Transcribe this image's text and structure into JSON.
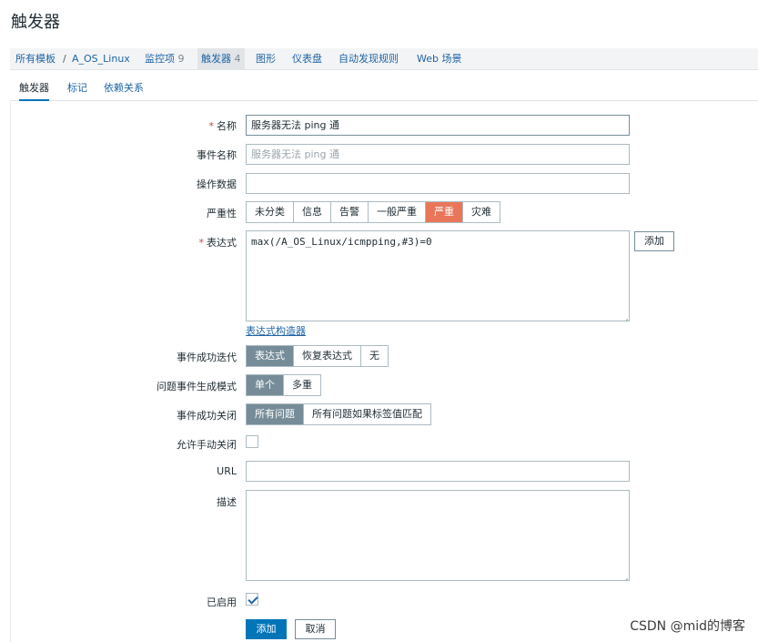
{
  "page": {
    "title": "触发器"
  },
  "breadcrumb": {
    "all_templates": "所有模板",
    "separator": "/",
    "template_name": "A_OS_Linux",
    "items_label": "监控项",
    "items_count": "9",
    "triggers_label": "触发器",
    "triggers_count": "4",
    "graphs": "图形",
    "dashboards": "仪表盘",
    "discovery": "自动发现规则",
    "web": "Web 场景"
  },
  "tabs": {
    "trigger": "触发器",
    "tags": "标记",
    "dependencies": "依赖关系"
  },
  "form": {
    "required_mark": "*",
    "name": {
      "label": "名称",
      "value": "服务器无法 ping 通"
    },
    "event_name": {
      "label": "事件名称",
      "placeholder": "服务器无法 ping 通"
    },
    "opdata": {
      "label": "操作数据",
      "value": ""
    },
    "severity": {
      "label": "严重性",
      "options": [
        "未分类",
        "信息",
        "告警",
        "一般严重",
        "严重",
        "灾难"
      ],
      "selected": "严重"
    },
    "expression": {
      "label": "表达式",
      "value": "max(/A_OS_Linux/icmpping,#3)=0",
      "add_button": "添加",
      "builder_link": "表达式构造器"
    },
    "ok_event_generation": {
      "label": "事件成功迭代",
      "options": [
        "表达式",
        "恢复表达式",
        "无"
      ],
      "selected": "表达式"
    },
    "problem_mode": {
      "label": "问题事件生成模式",
      "options": [
        "单个",
        "多重"
      ],
      "selected": "单个"
    },
    "ok_event_closes": {
      "label": "事件成功关闭",
      "options": [
        "所有问题",
        "所有问题如果标签值匹配"
      ],
      "selected": "所有问题"
    },
    "manual_close": {
      "label": "允许手动关闭",
      "checked": false
    },
    "url": {
      "label": "URL",
      "value": ""
    },
    "description": {
      "label": "描述",
      "value": ""
    },
    "enabled": {
      "label": "已启用",
      "checked": true
    },
    "submit_button": "添加",
    "cancel_button": "取消"
  },
  "watermark": "CSDN @mid的博客",
  "colors": {
    "accent": "#0275b8",
    "selected_gray": "#768d99",
    "severity_high": "#e97659",
    "link": "#1f65a6"
  }
}
